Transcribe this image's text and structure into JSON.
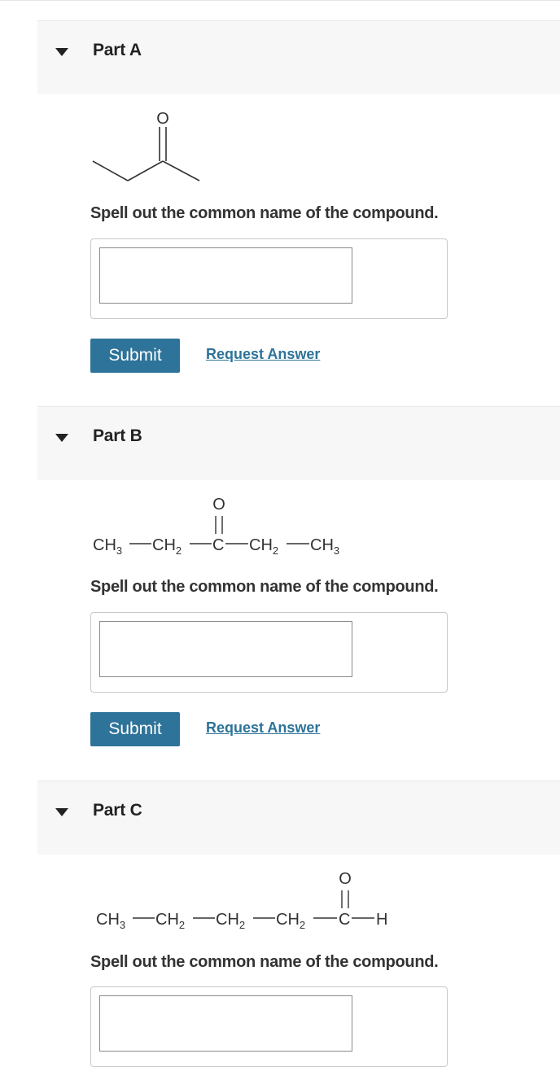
{
  "parts": [
    {
      "title": "Part A",
      "prompt": "Spell out the common name of the compound.",
      "answer_value": "",
      "submit_label": "Submit",
      "request_label": "Request Answer"
    },
    {
      "title": "Part B",
      "prompt": "Spell out the common name of the compound.",
      "answer_value": "",
      "submit_label": "Submit",
      "request_label": "Request Answer",
      "formula": {
        "oxygen": "O",
        "groups": [
          "CH",
          "3",
          "CH",
          "2",
          "C",
          "CH",
          "2",
          "CH",
          "3"
        ]
      }
    },
    {
      "title": "Part C",
      "prompt": "Spell out the common name of the compound.",
      "answer_value": "",
      "formula": {
        "oxygen": "O",
        "groups": [
          "CH",
          "3",
          "CH",
          "2",
          "CH",
          "2",
          "CH",
          "2",
          "C",
          "H"
        ]
      }
    }
  ],
  "molecule_a": {
    "oxygen": "O"
  },
  "colors": {
    "accent": "#2e7399",
    "header_bg": "#f7f7f7",
    "text": "#333333"
  },
  "icons": {
    "toggle": "triangle-down-icon"
  }
}
